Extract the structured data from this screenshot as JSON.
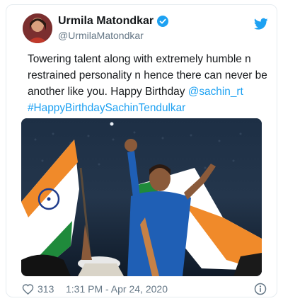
{
  "tweet": {
    "display_name": "Urmila Matondkar",
    "handle": "@UrmilaMatondkar",
    "text_before": "Towering talent along with extremely humble n restrained personality n hence there can never be another like you. Happy Birthday ",
    "mention": "@sachin_rt",
    "hashtag": "#HappyBirthdaySachinTendulkar",
    "likes": "313",
    "timestamp": "1:31 PM - Apr 24, 2020"
  },
  "icons": {
    "verified": "verified-badge-icon",
    "platform": "twitter-bird-icon",
    "like": "heart-icon",
    "info": "info-icon"
  },
  "colors": {
    "accent": "#1da1f2",
    "text": "#14171a",
    "muted": "#657786"
  }
}
